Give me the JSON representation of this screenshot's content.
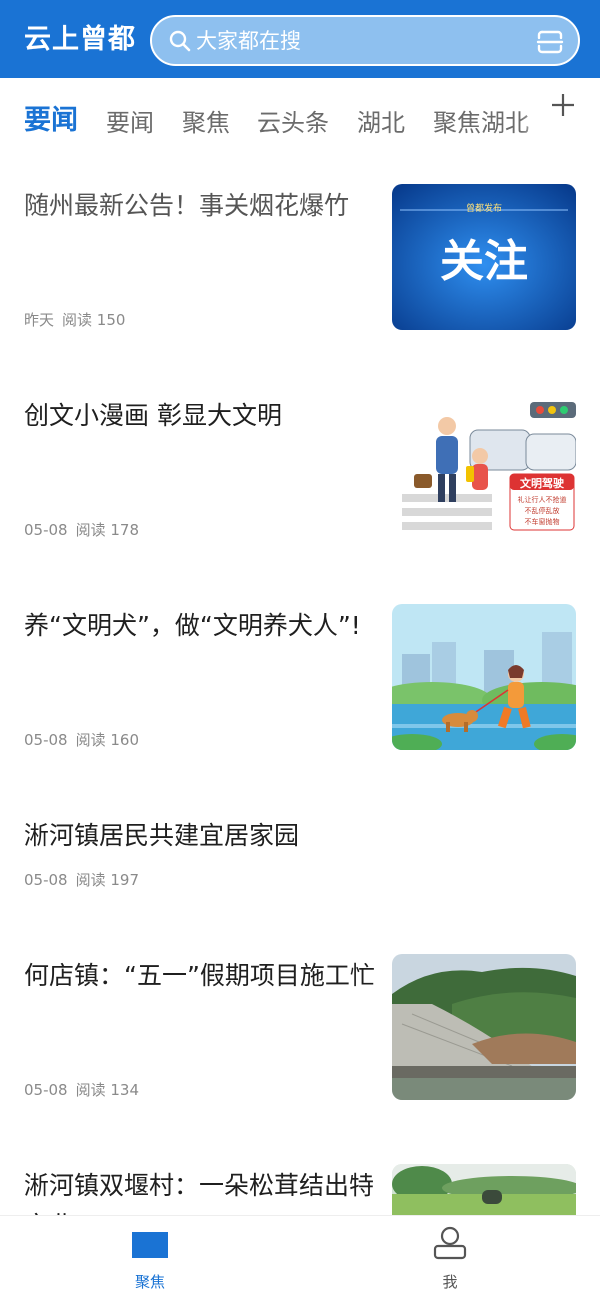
{
  "header": {
    "app_title": "云上曾都",
    "search_placeholder": "大家都在搜",
    "colors": {
      "brand": "#1a73d4",
      "search_bg": "#8ec0ef"
    }
  },
  "tabs": {
    "items": [
      {
        "label": "要闻",
        "active": true
      },
      {
        "label": "要闻",
        "active": false
      },
      {
        "label": "聚焦",
        "active": false
      },
      {
        "label": "云头条",
        "active": false
      },
      {
        "label": "湖北",
        "active": false
      },
      {
        "label": "聚焦湖北",
        "active": false
      }
    ],
    "add_icon": "plus-icon"
  },
  "feed": {
    "items": [
      {
        "title": "随州最新公告！事关烟花爆竹",
        "date": "昨天",
        "reads": "阅读 150",
        "thumb_caption": "关注",
        "thumb_badge": "曾都发布"
      },
      {
        "title": "创文小漫画 彰显大文明",
        "date": "05-08",
        "reads": "阅读 178",
        "thumb_caption": "文明驾驶",
        "thumb_line1": "礼让行人不抢道",
        "thumb_line2": "不乱停乱放",
        "thumb_line3": "不车窗抛物"
      },
      {
        "title": "养“文明犬”，做“文明养犬人”!",
        "date": "05-08",
        "reads": "阅读 160"
      },
      {
        "title": "淅河镇居民共建宜居家园",
        "date": "05-08",
        "reads": "阅读 197"
      },
      {
        "title": "何店镇：“五一”假期项目施工忙",
        "date": "05-08",
        "reads": "阅读 134"
      },
      {
        "title": "淅河镇双堰村：一朵松茸结出特产业",
        "date": "",
        "reads": ""
      }
    ]
  },
  "bottom_nav": {
    "items": [
      {
        "label": "聚焦",
        "icon": "news-icon",
        "active": true
      },
      {
        "label": "我",
        "icon": "user-icon",
        "active": false
      }
    ],
    "colors": {
      "active": "#1a73d4",
      "inactive": "#555555"
    }
  }
}
